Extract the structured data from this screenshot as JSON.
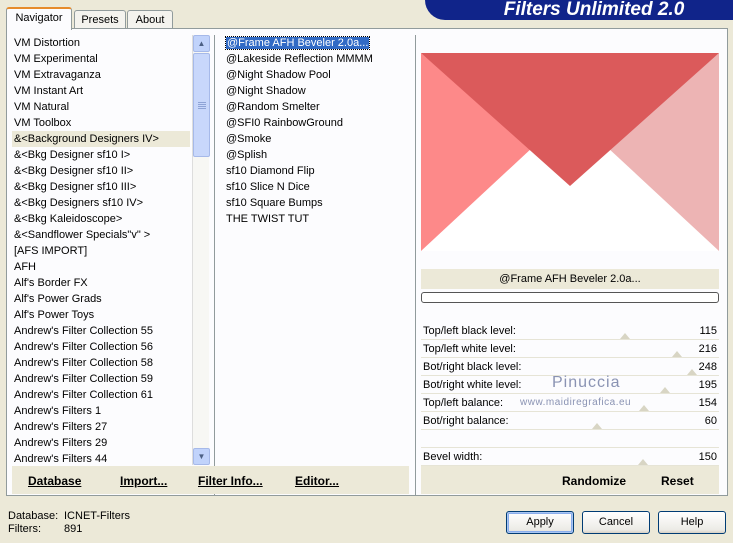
{
  "window": {
    "banner_title": "Filters Unlimited 2.0"
  },
  "tabs": [
    {
      "label": "Navigator",
      "active": true
    },
    {
      "label": "Presets",
      "active": false
    },
    {
      "label": "About",
      "active": false
    }
  ],
  "categories": [
    "VM Distortion",
    "VM Experimental",
    "VM Extravaganza",
    "VM Instant Art",
    "VM Natural",
    "VM Toolbox",
    "&<Background Designers IV>",
    "&<Bkg Designer sf10 I>",
    "&<Bkg Designer sf10 II>",
    "&<Bkg Designer sf10 III>",
    "&<Bkg Designers sf10 IV>",
    "&<Bkg Kaleidoscope>",
    "&<Sandflower Specials\"v\" >",
    "[AFS IMPORT]",
    "AFH",
    "Alf's Border FX",
    "Alf's Power Grads",
    "Alf's Power Toys",
    "Andrew's Filter Collection 55",
    "Andrew's Filter Collection 56",
    "Andrew's Filter Collection 58",
    "Andrew's Filter Collection 59",
    "Andrew's Filter Collection 61",
    "Andrew's Filters 1",
    "Andrew's Filters 27",
    "Andrew's Filters 29",
    "Andrew's Filters 44"
  ],
  "selected_category_index": 6,
  "filters": [
    "@Frame AFH Beveler 2.0a...",
    "@Lakeside Reflection MMMM",
    "@Night Shadow Pool",
    "@Night Shadow",
    "@Random Smelter",
    "@SFI0 RainbowGround",
    "@Smoke",
    "@Splish",
    "sf10 Diamond Flip",
    "sf10 Slice N Dice",
    "sf10 Square Bumps",
    "THE TWIST TUT"
  ],
  "selected_filter_index": 0,
  "preview": {
    "title": "@Frame AFH Beveler 2.0a...",
    "colors": {
      "top": "#db5a5b",
      "left": "#fd8989",
      "right": "#edb4b4",
      "bottom": "#ffffff"
    }
  },
  "params": [
    {
      "label": "Top/left black level:",
      "value": "115",
      "level": 0.45
    },
    {
      "label": "Top/left white level:",
      "value": "216",
      "level": 0.85
    },
    {
      "label": "Bot/right black level:",
      "value": "248",
      "level": 0.97
    },
    {
      "label": "Bot/right white level:",
      "value": "195",
      "level": 0.76
    },
    {
      "label": "Top/left balance:",
      "value": "154",
      "level": 0.6
    },
    {
      "label": "Bot/right balance:",
      "value": "60",
      "level": 0.24
    },
    {
      "label": "",
      "value": "",
      "level": null
    },
    {
      "label": "Bevel width:",
      "value": "150",
      "level": 0.59
    }
  ],
  "watermark": {
    "name": "Pinuccia",
    "site": "www.maidiregrafica.eu"
  },
  "links": {
    "database": "Database",
    "import": "Import...",
    "filter_info": "Filter Info...",
    "editor": "Editor...",
    "randomize": "Randomize",
    "reset": "Reset"
  },
  "info": {
    "database_label": "Database:",
    "database_value": "ICNET-Filters",
    "filters_label": "Filters:",
    "filters_value": "891"
  },
  "buttons": {
    "apply": "Apply",
    "cancel": "Cancel",
    "help": "Help"
  }
}
